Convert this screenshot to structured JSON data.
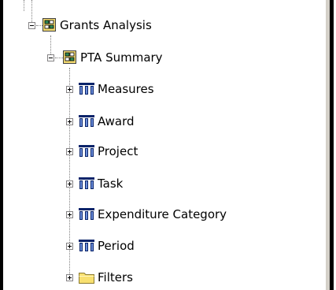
{
  "tree": {
    "root": {
      "label": "Grants Analysis",
      "icon": "cube-folder-icon",
      "state": "expanded"
    },
    "child": {
      "label": "PTA Summary",
      "icon": "cube-folder-icon",
      "state": "expanded"
    },
    "items": [
      {
        "label": "Measures",
        "icon": "dimension-icon",
        "state": "collapsed"
      },
      {
        "label": "Award",
        "icon": "dimension-icon",
        "state": "collapsed"
      },
      {
        "label": "Project",
        "icon": "dimension-icon",
        "state": "collapsed"
      },
      {
        "label": "Task",
        "icon": "dimension-icon",
        "state": "collapsed"
      },
      {
        "label": "Expenditure Category",
        "icon": "dimension-icon",
        "state": "collapsed"
      },
      {
        "label": "Period",
        "icon": "dimension-icon",
        "state": "collapsed"
      },
      {
        "label": "Filters",
        "icon": "folder-icon",
        "state": "collapsed"
      }
    ]
  },
  "colors": {
    "dimension_blue": "#0a246a",
    "folder_yellow": "#f8e070",
    "cube_green": "#2e8b57"
  }
}
